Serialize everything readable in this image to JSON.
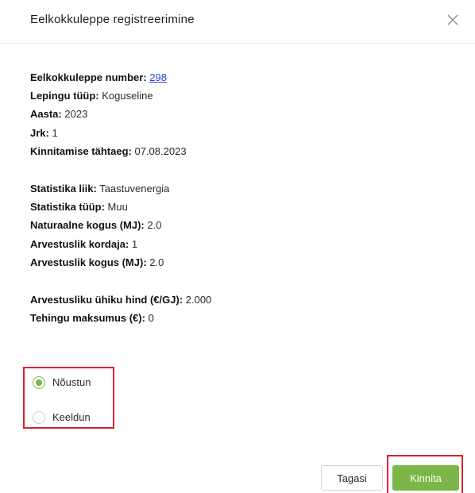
{
  "dialog": {
    "title": "Eelkokkuleppe registreerimine"
  },
  "details": {
    "agreement_number_label": "Eelkokkuleppe number:",
    "agreement_number": "298",
    "contract_type_label": "Lepingu tüüp:",
    "contract_type": "Koguseline",
    "year_label": "Aasta:",
    "year": "2023",
    "seq_label": "Jrk:",
    "seq": "1",
    "deadline_label": "Kinnitamise tähtaeg:",
    "deadline": "07.08.2023",
    "stat_kind_label": "Statistika liik:",
    "stat_kind": "Taastuvenergia",
    "stat_type_label": "Statistika tüüp:",
    "stat_type": "Muu",
    "natural_qty_label": "Naturaalne kogus (MJ):",
    "natural_qty": "2.0",
    "calc_factor_label": "Arvestuslik kordaja:",
    "calc_factor": "1",
    "calc_qty_label": "Arvestuslik kogus (MJ):",
    "calc_qty": "2.0",
    "unit_price_label": "Arvestusliku ühiku hind (€/GJ):",
    "unit_price": "2.000",
    "transaction_cost_label": "Tehingu maksumus (€):",
    "transaction_cost": "0"
  },
  "decision": {
    "selected": "agree",
    "agree_label": "Nõustun",
    "decline_label": "Keeldun"
  },
  "actions": {
    "back_label": "Tagasi",
    "confirm_label": "Kinnita"
  },
  "colors": {
    "accent": "#7ab648",
    "highlight": "#d9232d",
    "link": "#2f3fe0"
  },
  "icons": {
    "close": "close-icon"
  }
}
